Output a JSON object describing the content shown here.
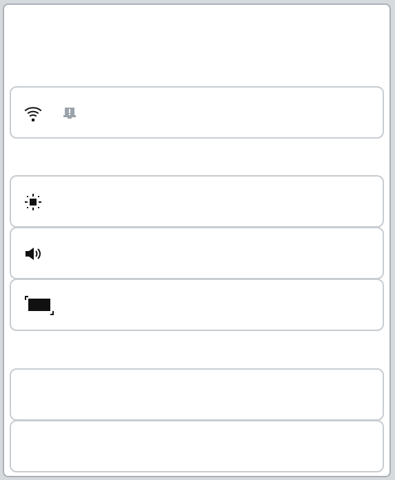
{
  "panel": {
    "rows": [
      {
        "id": "network",
        "icon": "wifi-icon",
        "secondary_icon": "notification-bell-alert-icon"
      },
      {
        "id": "brightness",
        "icon": "sun-brightness-icon"
      },
      {
        "id": "volume",
        "icon": "speaker-volume-icon"
      },
      {
        "id": "display",
        "icon": "screen-display-icon"
      },
      {
        "id": "empty-1"
      },
      {
        "id": "empty-2"
      }
    ]
  },
  "colors": {
    "page_background": "#d7dadd",
    "window_border": "#aab0b6",
    "row_border": "#c7ccd1",
    "icon_primary": "#111111",
    "icon_secondary": "#9aa2aa"
  }
}
